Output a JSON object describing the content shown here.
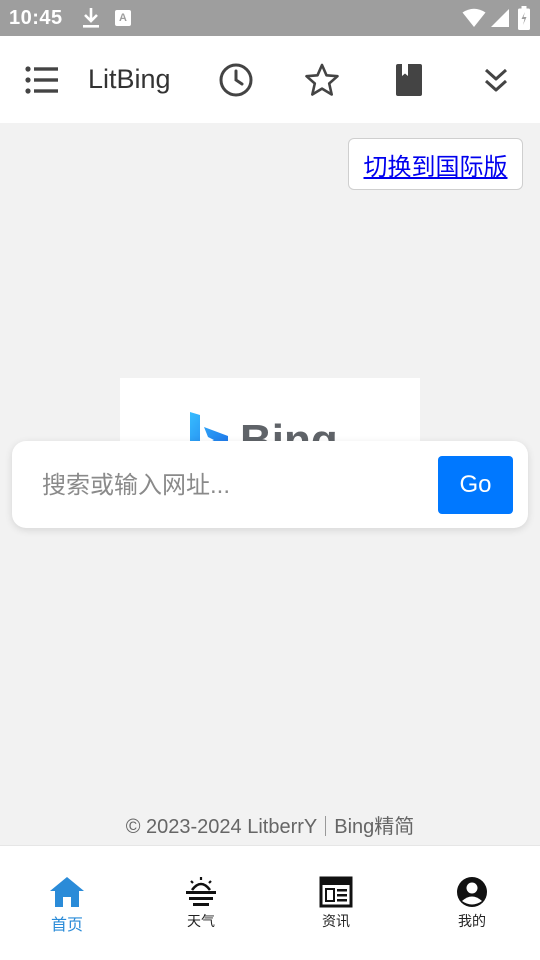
{
  "status_bar": {
    "time": "10:45",
    "notification_a": "A"
  },
  "app_bar": {
    "title": "LitBing",
    "icons": [
      "menu-icon",
      "history-icon",
      "star-icon",
      "bookmark-icon",
      "double-chevron-down-icon"
    ]
  },
  "switch_button": {
    "label": "切换到国际版"
  },
  "logo": {
    "text": "Bing"
  },
  "search": {
    "placeholder": "搜索或输入网址...",
    "value": "",
    "go_label": "Go"
  },
  "footer": {
    "copyright": "© 2023-2024 LitberrY",
    "site": "Bing精简"
  },
  "bottom_nav": {
    "items": [
      {
        "label": "首页",
        "icon": "home-icon",
        "active": true
      },
      {
        "label": "天气",
        "icon": "weather-icon",
        "active": false
      },
      {
        "label": "资讯",
        "icon": "news-icon",
        "active": false
      },
      {
        "label": "我的",
        "icon": "account-icon",
        "active": false
      }
    ]
  },
  "colors": {
    "accent": "#0078ff",
    "active_nav": "#2a8bd8",
    "link": "#0000ee",
    "background": "#f2f2f2",
    "status_bar": "#9e9e9e"
  }
}
